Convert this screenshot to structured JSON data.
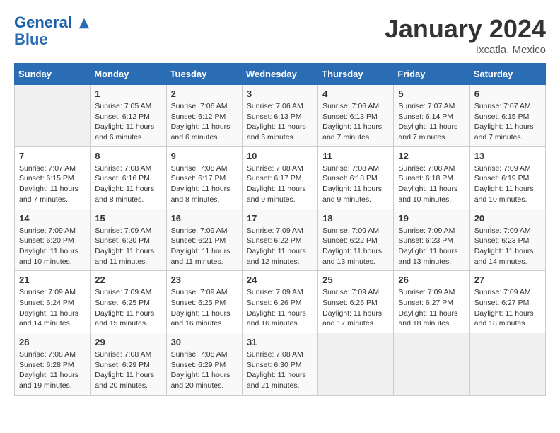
{
  "header": {
    "logo_line1": "General",
    "logo_line2": "Blue",
    "month": "January 2024",
    "location": "Ixcatla, Mexico"
  },
  "days_of_week": [
    "Sunday",
    "Monday",
    "Tuesday",
    "Wednesday",
    "Thursday",
    "Friday",
    "Saturday"
  ],
  "weeks": [
    [
      {
        "day": "",
        "info": ""
      },
      {
        "day": "1",
        "info": "Sunrise: 7:05 AM\nSunset: 6:12 PM\nDaylight: 11 hours\nand 6 minutes."
      },
      {
        "day": "2",
        "info": "Sunrise: 7:06 AM\nSunset: 6:12 PM\nDaylight: 11 hours\nand 6 minutes."
      },
      {
        "day": "3",
        "info": "Sunrise: 7:06 AM\nSunset: 6:13 PM\nDaylight: 11 hours\nand 6 minutes."
      },
      {
        "day": "4",
        "info": "Sunrise: 7:06 AM\nSunset: 6:13 PM\nDaylight: 11 hours\nand 7 minutes."
      },
      {
        "day": "5",
        "info": "Sunrise: 7:07 AM\nSunset: 6:14 PM\nDaylight: 11 hours\nand 7 minutes."
      },
      {
        "day": "6",
        "info": "Sunrise: 7:07 AM\nSunset: 6:15 PM\nDaylight: 11 hours\nand 7 minutes."
      }
    ],
    [
      {
        "day": "7",
        "info": "Sunrise: 7:07 AM\nSunset: 6:15 PM\nDaylight: 11 hours\nand 7 minutes."
      },
      {
        "day": "8",
        "info": "Sunrise: 7:08 AM\nSunset: 6:16 PM\nDaylight: 11 hours\nand 8 minutes."
      },
      {
        "day": "9",
        "info": "Sunrise: 7:08 AM\nSunset: 6:17 PM\nDaylight: 11 hours\nand 8 minutes."
      },
      {
        "day": "10",
        "info": "Sunrise: 7:08 AM\nSunset: 6:17 PM\nDaylight: 11 hours\nand 9 minutes."
      },
      {
        "day": "11",
        "info": "Sunrise: 7:08 AM\nSunset: 6:18 PM\nDaylight: 11 hours\nand 9 minutes."
      },
      {
        "day": "12",
        "info": "Sunrise: 7:08 AM\nSunset: 6:18 PM\nDaylight: 11 hours\nand 10 minutes."
      },
      {
        "day": "13",
        "info": "Sunrise: 7:09 AM\nSunset: 6:19 PM\nDaylight: 11 hours\nand 10 minutes."
      }
    ],
    [
      {
        "day": "14",
        "info": "Sunrise: 7:09 AM\nSunset: 6:20 PM\nDaylight: 11 hours\nand 10 minutes."
      },
      {
        "day": "15",
        "info": "Sunrise: 7:09 AM\nSunset: 6:20 PM\nDaylight: 11 hours\nand 11 minutes."
      },
      {
        "day": "16",
        "info": "Sunrise: 7:09 AM\nSunset: 6:21 PM\nDaylight: 11 hours\nand 11 minutes."
      },
      {
        "day": "17",
        "info": "Sunrise: 7:09 AM\nSunset: 6:22 PM\nDaylight: 11 hours\nand 12 minutes."
      },
      {
        "day": "18",
        "info": "Sunrise: 7:09 AM\nSunset: 6:22 PM\nDaylight: 11 hours\nand 13 minutes."
      },
      {
        "day": "19",
        "info": "Sunrise: 7:09 AM\nSunset: 6:23 PM\nDaylight: 11 hours\nand 13 minutes."
      },
      {
        "day": "20",
        "info": "Sunrise: 7:09 AM\nSunset: 6:23 PM\nDaylight: 11 hours\nand 14 minutes."
      }
    ],
    [
      {
        "day": "21",
        "info": "Sunrise: 7:09 AM\nSunset: 6:24 PM\nDaylight: 11 hours\nand 14 minutes."
      },
      {
        "day": "22",
        "info": "Sunrise: 7:09 AM\nSunset: 6:25 PM\nDaylight: 11 hours\nand 15 minutes."
      },
      {
        "day": "23",
        "info": "Sunrise: 7:09 AM\nSunset: 6:25 PM\nDaylight: 11 hours\nand 16 minutes."
      },
      {
        "day": "24",
        "info": "Sunrise: 7:09 AM\nSunset: 6:26 PM\nDaylight: 11 hours\nand 16 minutes."
      },
      {
        "day": "25",
        "info": "Sunrise: 7:09 AM\nSunset: 6:26 PM\nDaylight: 11 hours\nand 17 minutes."
      },
      {
        "day": "26",
        "info": "Sunrise: 7:09 AM\nSunset: 6:27 PM\nDaylight: 11 hours\nand 18 minutes."
      },
      {
        "day": "27",
        "info": "Sunrise: 7:09 AM\nSunset: 6:27 PM\nDaylight: 11 hours\nand 18 minutes."
      }
    ],
    [
      {
        "day": "28",
        "info": "Sunrise: 7:08 AM\nSunset: 6:28 PM\nDaylight: 11 hours\nand 19 minutes."
      },
      {
        "day": "29",
        "info": "Sunrise: 7:08 AM\nSunset: 6:29 PM\nDaylight: 11 hours\nand 20 minutes."
      },
      {
        "day": "30",
        "info": "Sunrise: 7:08 AM\nSunset: 6:29 PM\nDaylight: 11 hours\nand 20 minutes."
      },
      {
        "day": "31",
        "info": "Sunrise: 7:08 AM\nSunset: 6:30 PM\nDaylight: 11 hours\nand 21 minutes."
      },
      {
        "day": "",
        "info": ""
      },
      {
        "day": "",
        "info": ""
      },
      {
        "day": "",
        "info": ""
      }
    ]
  ]
}
